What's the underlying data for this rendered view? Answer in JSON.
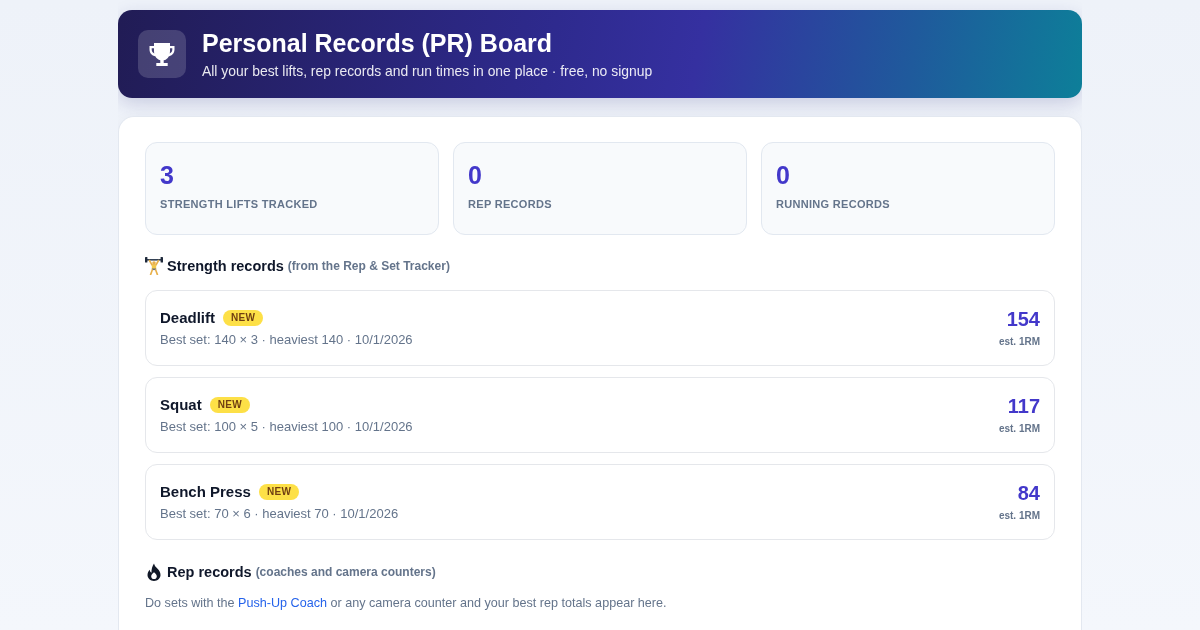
{
  "header": {
    "title": "Personal Records (PR) Board",
    "subtitle": "All your best lifts, rep records and run times in one place · free, no signup"
  },
  "stats": [
    {
      "value": "3",
      "label": "STRENGTH LIFTS TRACKED"
    },
    {
      "value": "0",
      "label": "REP RECORDS"
    },
    {
      "value": "0",
      "label": "RUNNING RECORDS"
    }
  ],
  "sections": [
    {
      "kind": "strength",
      "title": "Strength records",
      "note": "(from the Rep & Set Tracker)",
      "records": [
        {
          "name": "Deadlift",
          "badge": "NEW",
          "detail": "Best set: 140 × 3 · heaviest 140 · 10/1/2026",
          "value": "154",
          "value_label": "est. 1RM"
        },
        {
          "name": "Squat",
          "badge": "NEW",
          "detail": "Best set: 100 × 5 · heaviest 100 · 10/1/2026",
          "value": "117",
          "value_label": "est. 1RM"
        },
        {
          "name": "Bench Press",
          "badge": "NEW",
          "detail": "Best set: 70 × 6 · heaviest 70 · 10/1/2026",
          "value": "84",
          "value_label": "est. 1RM"
        }
      ]
    },
    {
      "kind": "reps",
      "title": "Rep records",
      "note": "(coaches and camera counters)",
      "empty_text": {
        "before": "Do sets with the",
        "link": "Push-Up Coach",
        "after": "or any camera counter and your best rep totals appear here."
      }
    }
  ]
}
